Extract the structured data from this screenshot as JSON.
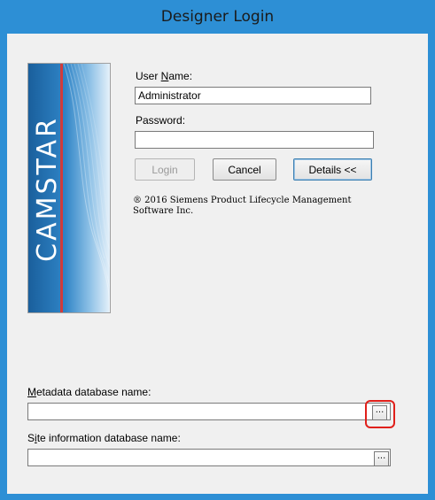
{
  "window": {
    "title": "Designer Login"
  },
  "logo": {
    "text": "CAMSTAR"
  },
  "form": {
    "username_label": "User Name:",
    "username_value": "Administrator",
    "password_label": "Password:",
    "password_value": "",
    "login_button": "Login",
    "cancel_button": "Cancel",
    "details_button": "Details <<",
    "copyright_line1": "® 2016 Siemens Product Lifecycle Management",
    "copyright_line2": "Software Inc.",
    "metadata_label": "Metadata database name:",
    "metadata_value": "",
    "metadata_browse": "...",
    "site_label": "Site information database name:",
    "site_value": "",
    "site_browse": "..."
  },
  "colors": {
    "title_bar": "#2d8fd5",
    "client_bg": "#f0f0f0",
    "logo_blue": "#1b6aa8",
    "logo_red_line": "#d23b3b",
    "highlight_red": "#e0201b"
  }
}
